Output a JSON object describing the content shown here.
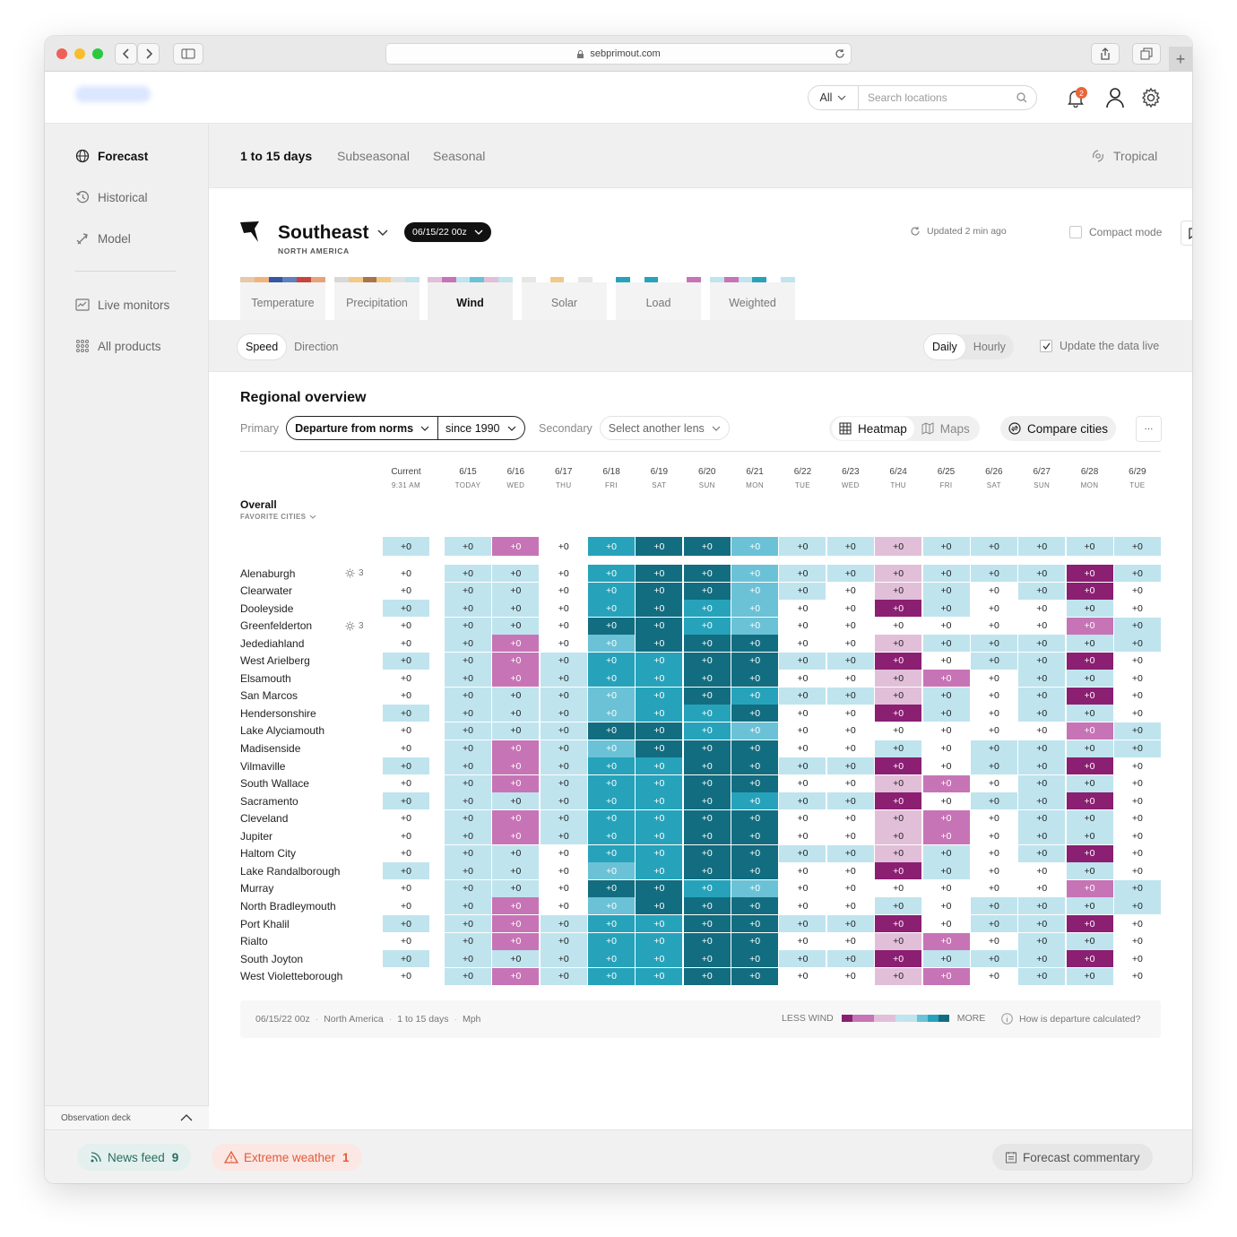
{
  "browser": {
    "url": "sebprimout.com"
  },
  "header": {
    "scope": "All",
    "search_placeholder": "Search locations",
    "notif_count": "2"
  },
  "sidebar": {
    "items": [
      {
        "label": "Forecast"
      },
      {
        "label": "Historical"
      },
      {
        "label": "Model"
      },
      {
        "label": "Live monitors"
      },
      {
        "label": "All products"
      }
    ],
    "observation": "Observation deck"
  },
  "subnav": {
    "tabs": [
      {
        "label": "1 to 15 days"
      },
      {
        "label": "Subseasonal"
      },
      {
        "label": "Seasonal"
      }
    ],
    "tropical": "Tropical"
  },
  "region": {
    "name": "Southeast",
    "sub": "NORTH AMERICA",
    "date": "06/15/22 00z",
    "updated": "Updated 2 min ago",
    "compact": "Compact mode"
  },
  "vars": [
    {
      "label": "Temperature"
    },
    {
      "label": "Precipitation"
    },
    {
      "label": "Wind"
    },
    {
      "label": "Solar"
    },
    {
      "label": "Load"
    },
    {
      "label": "Weighted"
    }
  ],
  "tools": {
    "speed": "Speed",
    "direction": "Direction",
    "daily": "Daily",
    "hourly": "Hourly",
    "live": "Update the data live"
  },
  "overview": {
    "title": "Regional overview",
    "primary": "Primary",
    "lens": "Departure from norms",
    "since": "since 1990",
    "secondary": "Secondary",
    "another": "Select another lens",
    "heatmap": "Heatmap",
    "maps": "Maps",
    "compare": "Compare cities",
    "more": "···"
  },
  "table": {
    "columns": [
      {
        "d": "Current",
        "s": "9:31 AM"
      },
      {
        "d": "6/15",
        "s": "TODAY"
      },
      {
        "d": "6/16",
        "s": "WED"
      },
      {
        "d": "6/17",
        "s": "THU"
      },
      {
        "d": "6/18",
        "s": "FRI"
      },
      {
        "d": "6/19",
        "s": "SAT"
      },
      {
        "d": "6/20",
        "s": "SUN"
      },
      {
        "d": "6/21",
        "s": "MON"
      },
      {
        "d": "6/22",
        "s": "TUE"
      },
      {
        "d": "6/23",
        "s": "WED"
      },
      {
        "d": "6/24",
        "s": "THU"
      },
      {
        "d": "6/25",
        "s": "FRI"
      },
      {
        "d": "6/26",
        "s": "SAT"
      },
      {
        "d": "6/27",
        "s": "SUN"
      },
      {
        "d": "6/28",
        "s": "MON"
      },
      {
        "d": "6/29",
        "s": "TUE"
      }
    ],
    "overall": {
      "label": "Overall",
      "sub": "FAVORITE CITIES",
      "cells": "S S M W B N N C S S P S S S S S"
    },
    "rows": [
      {
        "name": "Alenaburgh",
        "fav": "3",
        "cells": "W S S W B N N C S S P S S S D S"
      },
      {
        "name": "Clearwater",
        "cells": "W S S W B N N C S W P S W S D W"
      },
      {
        "name": "Dooleyside",
        "cells": "S S S W B N B C W W D S W W S W"
      },
      {
        "name": "Greenfelderton",
        "fav": "3",
        "cells": "W S S W N N B C W W W W W W M S"
      },
      {
        "name": "Jedediahland",
        "cells": "W S M W C N N N W W P S S S S S"
      },
      {
        "name": "West Arielberg",
        "cells": "S S M S B B N N S S D W S S D W"
      },
      {
        "name": "Elsamouth",
        "cells": "W S M S B B N N W W P M W S S W"
      },
      {
        "name": "San Marcos",
        "cells": "W S S S C B N B S S P S W S D W"
      },
      {
        "name": "Hendersonshire",
        "cells": "S S S S C B B N W W D S W S S W"
      },
      {
        "name": "Lake Alyciamouth",
        "cells": "W S S S N N B C W W W W W W M S"
      },
      {
        "name": "Madisenside",
        "cells": "W S M S C N N N W W S W S S S S"
      },
      {
        "name": "Vilmaville",
        "cells": "S S M S B B N N S S D W S S D W"
      },
      {
        "name": "South Wallace",
        "cells": "W S M S B B N N W W P M W S S W"
      },
      {
        "name": "Sacramento",
        "cells": "S S S S B B N B S S D W S S D W"
      },
      {
        "name": "Cleveland",
        "cells": "W S M S B B N N W W P M W S S W"
      },
      {
        "name": "Jupiter",
        "cells": "W S M S B B N N W W P M W S S W"
      },
      {
        "name": "Haltom City",
        "cells": "W S S W B B N N S S P S W S D W"
      },
      {
        "name": "Lake Randalborough",
        "cells": "S S S W C B N N W W D S W W S W"
      },
      {
        "name": "Murray",
        "cells": "W S S W N N B C W W W W W W M S"
      },
      {
        "name": "North Bradleymouth",
        "cells": "W S M W C N N N W W S W S S S S"
      },
      {
        "name": "Port Khalil",
        "cells": "S S M S B B N N S S D W S S D W"
      },
      {
        "name": "Rialto",
        "cells": "W S M S B B N N W W P M W S S W"
      },
      {
        "name": "South Joyton",
        "cells": "S S S S B B N N S S D S S S D W"
      },
      {
        "name": "West Violetteborough",
        "cells": "W S M S B B N N W W P M W S S W"
      }
    ],
    "value": "+0"
  },
  "legend": {
    "meta": [
      "06/15/22 00z",
      "North America",
      "1 to 15 days",
      "Mph"
    ],
    "less": "LESS WIND",
    "more": "MORE",
    "how": "How is departure calculated?"
  },
  "bottom": {
    "news": "News feed",
    "news_count": "9",
    "extreme": "Extreme weather",
    "extreme_count": "1",
    "commentary": "Forecast commentary"
  },
  "colors": {
    "W": "#ffffff",
    "S": "#bfe4ee",
    "C": "#6bc2d6",
    "B": "#26a3bb",
    "N": "#126d80",
    "P": "#e2bfd8",
    "M": "#c774b6",
    "D": "#8b1f72"
  }
}
